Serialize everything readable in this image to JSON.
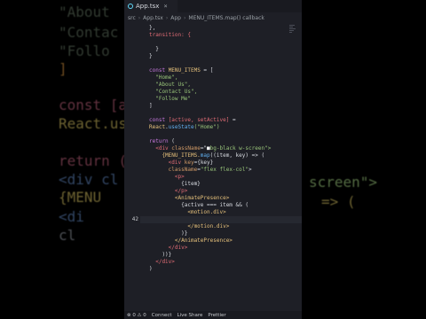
{
  "background": {
    "lines": [
      {
        "segments": [
          {
            "text": "\"About",
            "color": "#5b6b5a"
          }
        ]
      },
      {
        "segments": [
          {
            "text": "\"Contac",
            "color": "#5b6b5a"
          }
        ]
      },
      {
        "segments": [
          {
            "text": "\"Follo",
            "color": "#5b6b5a"
          }
        ]
      },
      {
        "segments": [
          {
            "text": "]",
            "color": "#c78a3b"
          }
        ]
      },
      {
        "segments": [
          {
            "text": "const [ac",
            "color": "#b25b73"
          }
        ]
      },
      {
        "segments": [
          {
            "text": "React.use",
            "color": "#c6b35a"
          }
        ]
      },
      {
        "segments": [
          {
            "text": "return (",
            "color": "#b25b73"
          }
        ]
      },
      {
        "segments": [
          {
            "text": "<div cl",
            "color": "#5b7fb5"
          }
        ]
      },
      {
        "segments": [
          {
            "text": "{MENU",
            "color": "#c6b35a"
          }
        ]
      },
      {
        "segments": [
          {
            "text": "<di",
            "color": "#5b7fb5"
          }
        ]
      },
      {
        "segments": [
          {
            "text": "cl",
            "color": "#8a8f98"
          }
        ]
      }
    ],
    "right_fragments": [
      "screen\">",
      "=> ("
    ]
  },
  "editor": {
    "tab": {
      "label": "App.tsx",
      "close": "×"
    },
    "breadcrumb": [
      "src",
      "App.tsx",
      "App",
      "MENU_ITEMS.map() callback"
    ],
    "lines": [
      {
        "n": "",
        "segments": [
          {
            "t": "},",
            "c": "#d7dae0"
          }
        ]
      },
      {
        "n": "",
        "segments": [
          {
            "t": "transition: {",
            "c": "#e06c75"
          }
        ]
      },
      {
        "n": "",
        "segments": [
          {
            "t": "",
            "c": "#d7dae0"
          }
        ]
      },
      {
        "n": "",
        "segments": [
          {
            "t": "  }",
            "c": "#d7dae0"
          }
        ]
      },
      {
        "n": "",
        "segments": [
          {
            "t": "}",
            "c": "#d7dae0"
          }
        ]
      },
      {
        "n": "",
        "segments": [
          {
            "t": "",
            "c": "#d7dae0"
          }
        ]
      },
      {
        "n": "",
        "segments": [
          {
            "t": "const ",
            "c": "#c678dd"
          },
          {
            "t": "MENU_ITEMS",
            "c": "#e5c07b"
          },
          {
            "t": " = [",
            "c": "#d7dae0"
          }
        ]
      },
      {
        "n": "",
        "segments": [
          {
            "t": "  \"Home\",",
            "c": "#98c379"
          }
        ]
      },
      {
        "n": "",
        "segments": [
          {
            "t": "  \"About Us\",",
            "c": "#98c379"
          }
        ]
      },
      {
        "n": "",
        "segments": [
          {
            "t": "  \"Contact Us\",",
            "c": "#98c379"
          }
        ]
      },
      {
        "n": "",
        "segments": [
          {
            "t": "  \"Follow Me\"",
            "c": "#98c379"
          }
        ]
      },
      {
        "n": "",
        "segments": [
          {
            "t": "]",
            "c": "#d7dae0"
          }
        ]
      },
      {
        "n": "",
        "segments": [
          {
            "t": "",
            "c": "#d7dae0"
          }
        ]
      },
      {
        "n": "",
        "segments": [
          {
            "t": "const ",
            "c": "#c678dd"
          },
          {
            "t": "[active, setActive]",
            "c": "#e06c75"
          },
          {
            "t": " =",
            "c": "#d7dae0"
          }
        ]
      },
      {
        "n": "",
        "segments": [
          {
            "t": "React",
            "c": "#e5c07b"
          },
          {
            "t": ".",
            "c": "#d7dae0"
          },
          {
            "t": "useState",
            "c": "#61afef"
          },
          {
            "t": "(\"Home\")",
            "c": "#98c379"
          }
        ]
      },
      {
        "n": "",
        "segments": [
          {
            "t": "",
            "c": "#d7dae0"
          }
        ]
      },
      {
        "n": "",
        "segments": [
          {
            "t": "return",
            "c": "#c678dd"
          },
          {
            "t": " (",
            "c": "#d7dae0"
          }
        ]
      },
      {
        "n": "",
        "segments": [
          {
            "t": "  <div ",
            "c": "#e06c75"
          },
          {
            "t": "className",
            "c": "#d19a66"
          },
          {
            "t": "=\"",
            "c": "#d7dae0"
          },
          {
            "t": "■",
            "c": "#f1f1f1"
          },
          {
            "t": "bg-black w-screen\">",
            "c": "#98c379"
          }
        ]
      },
      {
        "n": "",
        "segments": [
          {
            "t": "    {MENU_ITEMS.",
            "c": "#e5c07b"
          },
          {
            "t": "map",
            "c": "#61afef"
          },
          {
            "t": "((item, key) => (",
            "c": "#d7dae0"
          }
        ]
      },
      {
        "n": "",
        "segments": [
          {
            "t": "      <div ",
            "c": "#e06c75"
          },
          {
            "t": "key",
            "c": "#d19a66"
          },
          {
            "t": "={key}",
            "c": "#d7dae0"
          }
        ]
      },
      {
        "n": "",
        "segments": [
          {
            "t": "      className",
            "c": "#d19a66"
          },
          {
            "t": "=",
            "c": "#d7dae0"
          },
          {
            "t": "\"flex flex-col\"",
            "c": "#98c379"
          },
          {
            "t": ">",
            "c": "#d7dae0"
          }
        ]
      },
      {
        "n": "",
        "segments": [
          {
            "t": "        <p>",
            "c": "#e06c75"
          }
        ]
      },
      {
        "n": "",
        "segments": [
          {
            "t": "          {item}",
            "c": "#d7dae0"
          }
        ]
      },
      {
        "n": "",
        "segments": [
          {
            "t": "        </p>",
            "c": "#e06c75"
          }
        ]
      },
      {
        "n": "",
        "segments": [
          {
            "t": "        <AnimatePresence>",
            "c": "#e5c07b"
          }
        ]
      },
      {
        "n": "",
        "segments": [
          {
            "t": "          {active === item && (",
            "c": "#d7dae0"
          }
        ]
      },
      {
        "n": "",
        "segments": [
          {
            "t": "            <motion.div>",
            "c": "#e5c07b"
          }
        ]
      },
      {
        "n": "42",
        "active": true,
        "segments": [
          {
            "t": "",
            "c": "#d7dae0"
          }
        ]
      },
      {
        "n": "",
        "segments": [
          {
            "t": "            </motion.div>",
            "c": "#e5c07b"
          }
        ]
      },
      {
        "n": "",
        "segments": [
          {
            "t": "          )}",
            "c": "#d7dae0"
          }
        ]
      },
      {
        "n": "",
        "segments": [
          {
            "t": "        </AnimatePresence>",
            "c": "#e5c07b"
          }
        ]
      },
      {
        "n": "",
        "segments": [
          {
            "t": "      </div>",
            "c": "#e06c75"
          }
        ]
      },
      {
        "n": "",
        "segments": [
          {
            "t": "    ))}",
            "c": "#d7dae0"
          }
        ]
      },
      {
        "n": "",
        "segments": [
          {
            "t": "  </div>",
            "c": "#e06c75"
          }
        ]
      },
      {
        "n": "",
        "segments": [
          {
            "t": ")",
            "c": "#d7dae0"
          }
        ]
      }
    ],
    "status": [
      "⊗ 0 ⚠ 0",
      "Connect",
      "Live Share",
      "Prettier"
    ]
  }
}
